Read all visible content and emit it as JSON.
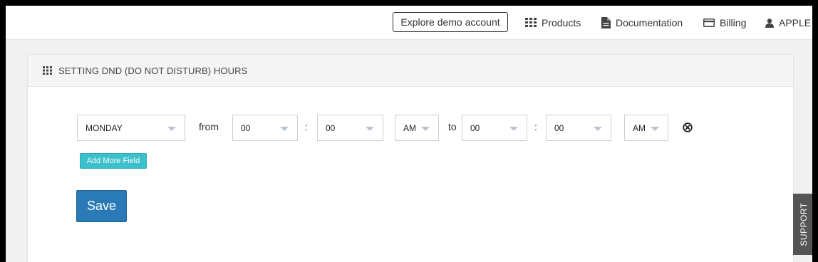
{
  "navbar": {
    "demo_button": "Explore demo account",
    "items": [
      {
        "label": "Products",
        "icon": "grid-icon"
      },
      {
        "label": "Documentation",
        "icon": "document-icon"
      },
      {
        "label": "Billing",
        "icon": "credit-card-icon"
      },
      {
        "label": "APPLE",
        "icon": "user-icon"
      }
    ]
  },
  "panel": {
    "title": "SETTING DND (DO NOT DISTURB) HOURS",
    "icon": "grid-icon"
  },
  "form": {
    "day": "MONDAY",
    "from_label": "from",
    "from_hour": "00",
    "from_sep": ":",
    "from_minute": "00",
    "from_ampm": "AM",
    "to_label": "to",
    "to_hour": "00",
    "to_sep": ":",
    "to_minute": "00",
    "to_ampm": "AM",
    "remove_icon": "close-circle-icon",
    "add_more_label": "Add More Field",
    "save_label": "Save"
  },
  "support": {
    "label": "SUPPORT"
  },
  "colors": {
    "save": "#2a7ab8",
    "add_more": "#3cc1cc",
    "support": "#555555"
  }
}
